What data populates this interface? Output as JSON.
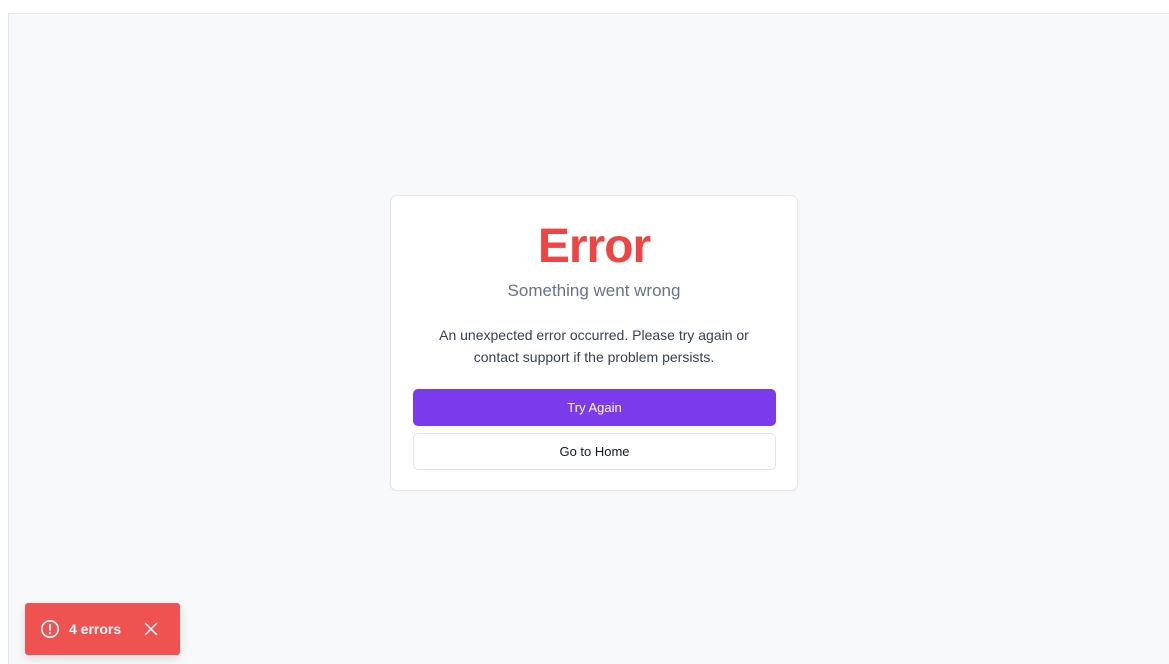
{
  "error_card": {
    "title": "Error",
    "subtitle": "Something went wrong",
    "message": "An unexpected error occurred. Please try again or contact support if the problem persists.",
    "primary_button_label": "Try Again",
    "secondary_button_label": "Go to Home"
  },
  "error_toast": {
    "label": "4 errors",
    "icon": "alert-circle-icon",
    "close_icon": "close-icon"
  },
  "colors": {
    "error_red": "#ef4444",
    "primary_purple": "#7c3aed",
    "toast_red": "#f05252",
    "background": "#f8f9fb"
  }
}
